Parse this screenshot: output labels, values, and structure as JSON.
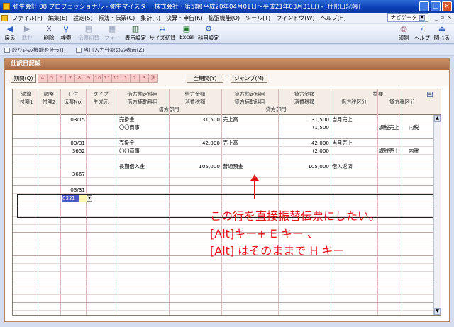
{
  "window": {
    "title": "弥生会計 08 プロフェッショナル - 弥生マイスター 株式会社・第5期(平成20年04月01日～平成21年03月31日) - [仕訳日記帳]"
  },
  "menu": {
    "items": [
      "ファイル(F)",
      "編集(E)",
      "設定(S)",
      "帳簿・伝票(C)",
      "集計(R)",
      "決算・申告(K)",
      "拡張機能(O)",
      "ツール(T)",
      "ウィンドウ(W)",
      "ヘルプ(H)"
    ],
    "navi_label": "ナビゲータ",
    "mdi": [
      "_",
      "▫",
      "×"
    ]
  },
  "toolbar": {
    "items": [
      "戻る",
      "進む",
      "削除",
      "検索",
      "伝票切替",
      "フォーム",
      "表示設定",
      "サイズ切替",
      "Excel",
      "科目設定"
    ],
    "right": [
      "印刷",
      "ヘルプ",
      "閉じる"
    ]
  },
  "options": {
    "opt1": "絞り込み機能を使う(I)",
    "opt2": "当日入力仕訳のみ表示(Z)"
  },
  "panel": {
    "title": "仕訳日記帳",
    "period_btn": "期間(Q)",
    "months": [
      "4",
      "5",
      "6",
      "7",
      "8",
      "9",
      "10",
      "11",
      "12",
      "1",
      "2",
      "3",
      "決"
    ],
    "all_period_btn": "全期間(Y)",
    "jump_btn": "ジャンプ(M)"
  },
  "grid": {
    "headers": {
      "row1": [
        "決算",
        "調整",
        "日付",
        "タイプ",
        "借方勘定科目",
        "借方金額",
        "貸方勘定科目",
        "貸方金額",
        "摘要"
      ],
      "row2": [
        "付箋1",
        "付箋2",
        "伝票No.",
        "生成元",
        "借方補助科目",
        "消費税額",
        "貸方補助科目",
        "消費税額",
        "借方税区分",
        "貸方税区分"
      ],
      "row3": [
        "借方部門",
        "貸方部門"
      ]
    },
    "entries": [
      {
        "date": "03/15",
        "no": "",
        "debit_acct": "売掛金",
        "debit_amt": "31,500",
        "credit_acct": "売上高",
        "credit_amt": "31,500",
        "memo": "当月売上",
        "debit_sub": "〇〇商事",
        "credit_tax": "(1,500",
        "credit_taxcls": "課税売上",
        "inc": "内税"
      },
      {
        "date": "03/31",
        "no": "3652",
        "debit_acct": "売掛金",
        "debit_amt": "42,000",
        "credit_acct": "売上高",
        "credit_amt": "42,000",
        "memo": "当月売上",
        "debit_sub": "〇〇商事",
        "credit_tax": "(2,000",
        "credit_taxcls": "課税売上",
        "inc": "内税"
      },
      {
        "date": "0331",
        "no": "3667",
        "debit_acct": "長期借入金",
        "debit_amt": "105,000",
        "credit_acct": "普通預金",
        "credit_amt": "105,000",
        "memo": "借入返済",
        "debit_sub": "",
        "credit_tax": "",
        "credit_taxcls": "",
        "inc": ""
      },
      {
        "date": "03/31",
        "no": "3668",
        "debit_acct": "",
        "debit_amt": "",
        "credit_acct": "",
        "credit_amt": "",
        "memo": "",
        "debit_sub": "",
        "credit_tax": "",
        "credit_taxcls": "",
        "inc": ""
      }
    ]
  },
  "annotation": {
    "line1": "この行を直接振替伝票にしたい。",
    "line2": "[Alt]キー+ E キー 、",
    "line3": "[Alt] はそのままで H キー"
  },
  "colors": {
    "annotation": "#e8101a",
    "panel_header": "#a86a44",
    "selection": "#4a58c8"
  }
}
